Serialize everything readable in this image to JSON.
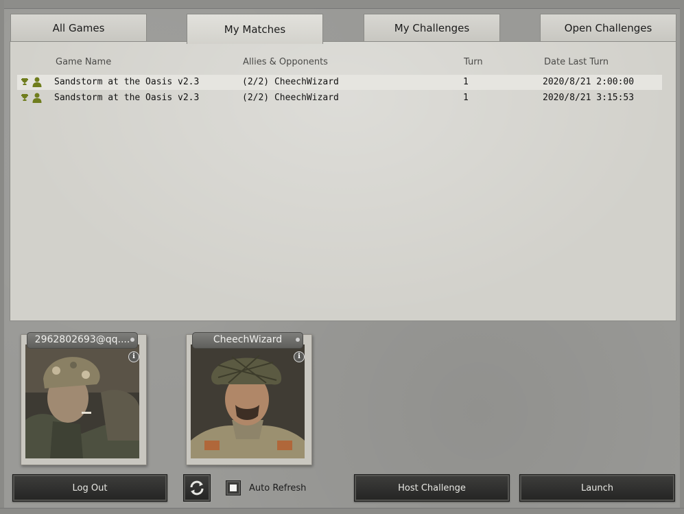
{
  "tabs": [
    {
      "label": "All Games",
      "active": false
    },
    {
      "label": "My Matches",
      "active": true
    },
    {
      "label": "My Challenges",
      "active": false
    },
    {
      "label": "Open Challenges",
      "active": false
    }
  ],
  "table": {
    "columns": [
      "Game Name",
      "Allies & Opponents",
      "Turn",
      "Date Last Turn"
    ],
    "rows": [
      {
        "game": "Sandstorm at the Oasis v2.3",
        "players": "(2/2) CheechWizard",
        "turn": "1",
        "date": "2020/8/21 2:00:00",
        "selected": true
      },
      {
        "game": "Sandstorm at the Oasis v2.3",
        "players": "(2/2) CheechWizard",
        "turn": "1",
        "date": "2020/8/21 3:15:53",
        "selected": false
      }
    ]
  },
  "players": [
    {
      "name": "2962802693@qq....",
      "info_icon": "info-icon"
    },
    {
      "name": "CheechWizard",
      "info_icon": "info-icon"
    }
  ],
  "buttons": {
    "logout": "Log Out",
    "auto_refresh_label": "Auto Refresh",
    "host_challenge": "Host Challenge",
    "launch": "Launch"
  },
  "auto_refresh_checked": false,
  "icons": {
    "row_icons": [
      "trophy-icon",
      "user-icon"
    ],
    "refresh": "refresh-icon"
  },
  "colors": {
    "icon_green": "#6f7d1d",
    "button_dark": "#2e2e2c",
    "panel": "#d2d1cb"
  }
}
